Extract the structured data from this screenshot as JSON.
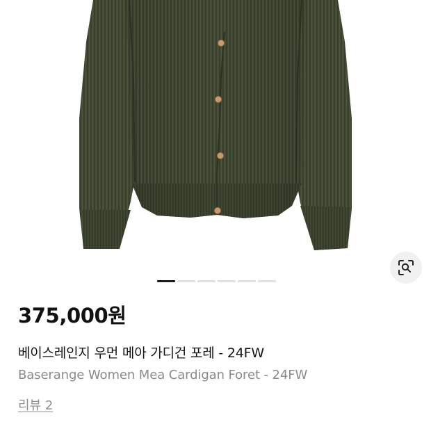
{
  "product": {
    "price": "375,000원",
    "title_ko": "베이스레인지 우먼 메아 가디건 포레 - 24FW",
    "title_en": "Baserange Women Mea Cardigan Foret - 24FW",
    "review_link": "리뷰 2"
  },
  "gallery": {
    "image_subject": "olive green ribbed knit cardigan",
    "slide_count": 6,
    "active_slide": 1,
    "lens_icon": "image-search-icon"
  },
  "colors": {
    "knit": "#434a34",
    "button": "#c99a6b",
    "pager_active": "#1c1c1c",
    "pager_inactive": "#e1e1e1",
    "price_text": "#111111",
    "secondary_text": "#8a8a8a"
  }
}
